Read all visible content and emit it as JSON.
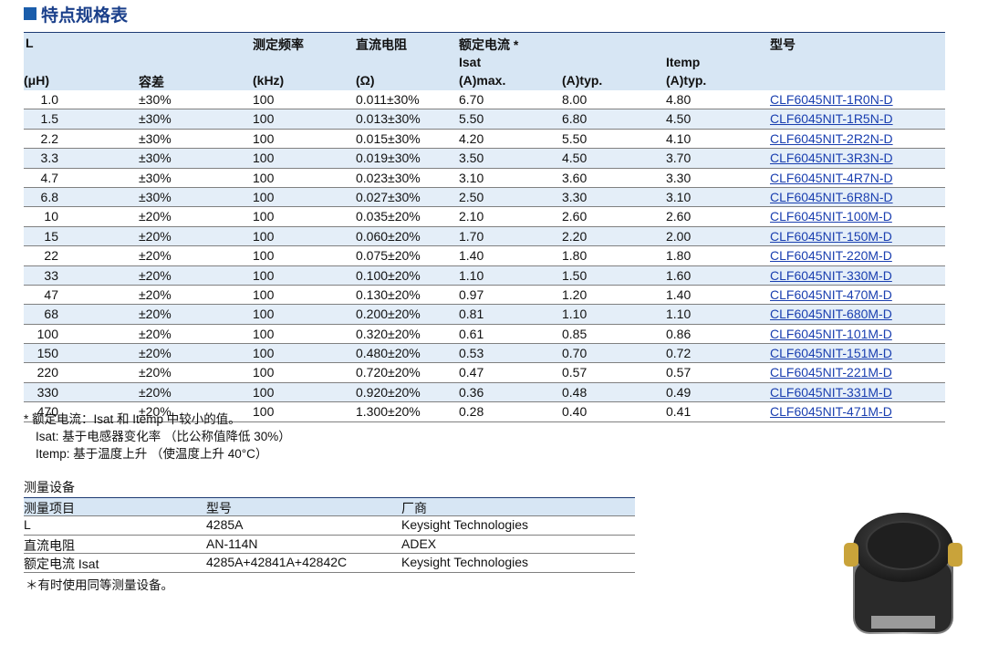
{
  "title": "特点规格表",
  "spec_table": {
    "headers": {
      "l_top": "L",
      "l_unit": "(μH)",
      "tolerance": "容差",
      "freq": "测定频率",
      "freq_unit": "(kHz)",
      "dcr": "直流电阻",
      "dcr_unit": "(Ω)",
      "rated": "额定电流 *",
      "isat": "Isat",
      "isat_max": "(A)max.",
      "isat_typ": "(A)typ.",
      "itemp": "Itemp",
      "itemp_typ": "(A)typ.",
      "part": "型号"
    },
    "rows": [
      {
        "l": "1.0",
        "tol": "±30%",
        "freq": "100",
        "dcr": "0.011±30%",
        "isat_max": "6.70",
        "isat_typ": "8.00",
        "itemp_typ": "4.80",
        "part": "CLF6045NIT-1R0N-D"
      },
      {
        "l": "1.5",
        "tol": "±30%",
        "freq": "100",
        "dcr": "0.013±30%",
        "isat_max": "5.50",
        "isat_typ": "6.80",
        "itemp_typ": "4.50",
        "part": "CLF6045NIT-1R5N-D"
      },
      {
        "l": "2.2",
        "tol": "±30%",
        "freq": "100",
        "dcr": "0.015±30%",
        "isat_max": "4.20",
        "isat_typ": "5.50",
        "itemp_typ": "4.10",
        "part": "CLF6045NIT-2R2N-D"
      },
      {
        "l": "3.3",
        "tol": "±30%",
        "freq": "100",
        "dcr": "0.019±30%",
        "isat_max": "3.50",
        "isat_typ": "4.50",
        "itemp_typ": "3.70",
        "part": "CLF6045NIT-3R3N-D"
      },
      {
        "l": "4.7",
        "tol": "±30%",
        "freq": "100",
        "dcr": "0.023±30%",
        "isat_max": "3.10",
        "isat_typ": "3.60",
        "itemp_typ": "3.30",
        "part": "CLF6045NIT-4R7N-D"
      },
      {
        "l": "6.8",
        "tol": "±30%",
        "freq": "100",
        "dcr": "0.027±30%",
        "isat_max": "2.50",
        "isat_typ": "3.30",
        "itemp_typ": "3.10",
        "part": "CLF6045NIT-6R8N-D"
      },
      {
        "l": "10",
        "tol": "±20%",
        "freq": "100",
        "dcr": "0.035±20%",
        "isat_max": "2.10",
        "isat_typ": "2.60",
        "itemp_typ": "2.60",
        "part": "CLF6045NIT-100M-D"
      },
      {
        "l": "15",
        "tol": "±20%",
        "freq": "100",
        "dcr": "0.060±20%",
        "isat_max": "1.70",
        "isat_typ": "2.20",
        "itemp_typ": "2.00",
        "part": "CLF6045NIT-150M-D"
      },
      {
        "l": "22",
        "tol": "±20%",
        "freq": "100",
        "dcr": "0.075±20%",
        "isat_max": "1.40",
        "isat_typ": "1.80",
        "itemp_typ": "1.80",
        "part": "CLF6045NIT-220M-D"
      },
      {
        "l": "33",
        "tol": "±20%",
        "freq": "100",
        "dcr": "0.100±20%",
        "isat_max": "1.10",
        "isat_typ": "1.50",
        "itemp_typ": "1.60",
        "part": "CLF6045NIT-330M-D"
      },
      {
        "l": "47",
        "tol": "±20%",
        "freq": "100",
        "dcr": "0.130±20%",
        "isat_max": "0.97",
        "isat_typ": "1.20",
        "itemp_typ": "1.40",
        "part": "CLF6045NIT-470M-D"
      },
      {
        "l": "68",
        "tol": "±20%",
        "freq": "100",
        "dcr": "0.200±20%",
        "isat_max": "0.81",
        "isat_typ": "1.10",
        "itemp_typ": "1.10",
        "part": "CLF6045NIT-680M-D"
      },
      {
        "l": "100",
        "tol": "±20%",
        "freq": "100",
        "dcr": "0.320±20%",
        "isat_max": "0.61",
        "isat_typ": "0.85",
        "itemp_typ": "0.86",
        "part": "CLF6045NIT-101M-D"
      },
      {
        "l": "150",
        "tol": "±20%",
        "freq": "100",
        "dcr": "0.480±20%",
        "isat_max": "0.53",
        "isat_typ": "0.70",
        "itemp_typ": "0.72",
        "part": "CLF6045NIT-151M-D"
      },
      {
        "l": "220",
        "tol": "±20%",
        "freq": "100",
        "dcr": "0.720±20%",
        "isat_max": "0.47",
        "isat_typ": "0.57",
        "itemp_typ": "0.57",
        "part": "CLF6045NIT-221M-D"
      },
      {
        "l": "330",
        "tol": "±20%",
        "freq": "100",
        "dcr": "0.920±20%",
        "isat_max": "0.36",
        "isat_typ": "0.48",
        "itemp_typ": "0.49",
        "part": "CLF6045NIT-331M-D"
      },
      {
        "l": "470",
        "tol": "±20%",
        "freq": "100",
        "dcr": "1.300±20%",
        "isat_max": "0.28",
        "isat_typ": "0.40",
        "itemp_typ": "0.41",
        "part": "CLF6045NIT-471M-D"
      }
    ]
  },
  "notes": {
    "line1": "* 额定电流：Isat 和 Itemp 中较小的值。",
    "line2": "Isat: 基于电感器变化率 （比公称值降低 30%）",
    "line3": "Itemp: 基于温度上升 （使温度上升 40°C）"
  },
  "equipment": {
    "title": "测量设备",
    "headers": [
      "测量项目",
      "型号",
      "厂商"
    ],
    "rows": [
      [
        "L",
        "4285A",
        "Keysight Technologies"
      ],
      [
        "直流电阻",
        "AN-114N",
        "ADEX"
      ],
      [
        "额定电流 Isat",
        "4285A+42841A+42842C",
        "Keysight Technologies"
      ]
    ],
    "footnote": "＊有时使用同等测量设备。"
  },
  "colors": {
    "header_bg": "#d7e6f4",
    "stripe_bg": "#e4eef8",
    "title_blue": "#1a3f8a",
    "link_blue": "#1a3fb0"
  }
}
